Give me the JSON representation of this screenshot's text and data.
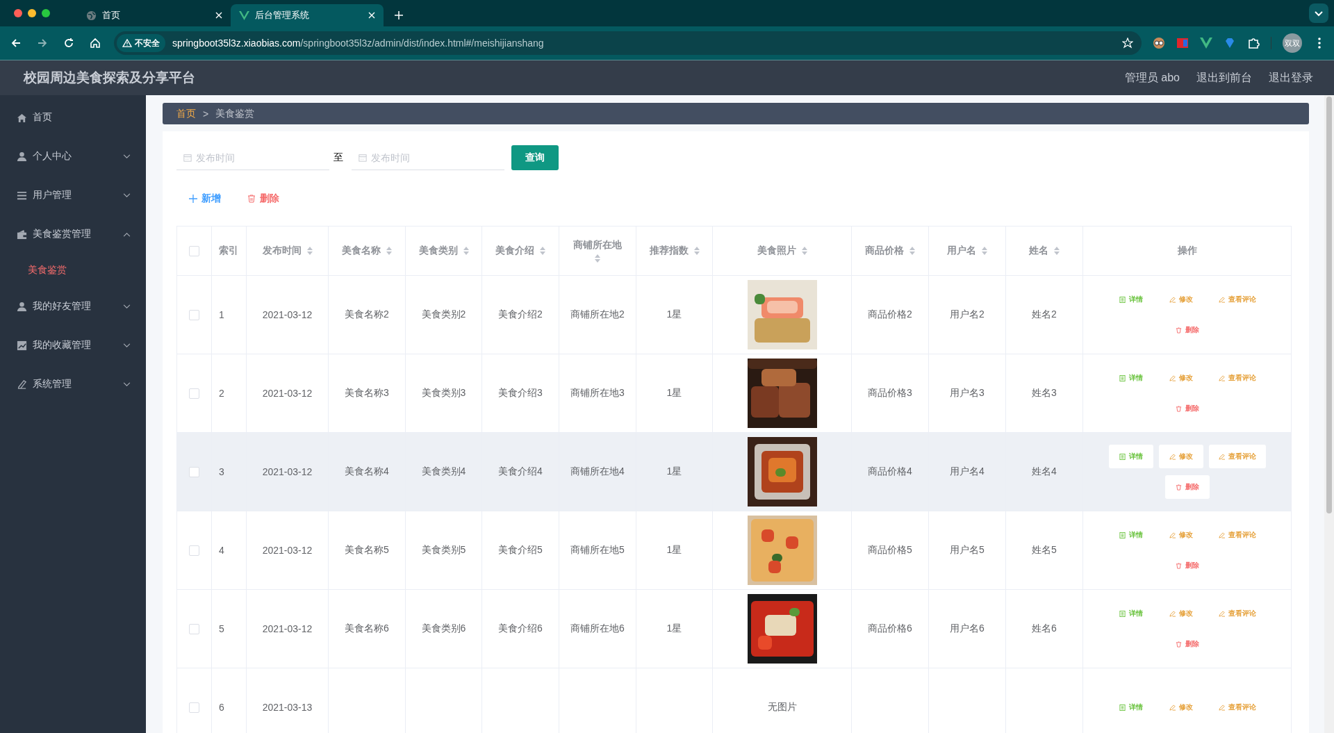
{
  "browser": {
    "tabs": [
      {
        "title": "首页",
        "selected": false
      },
      {
        "title": "后台管理系统",
        "selected": true
      }
    ],
    "security": "不安全",
    "url_host": "springboot35l3z.xiaobias.com",
    "url_path": "/springboot35l3z/admin/dist/index.html#/meishijianshang",
    "profile": "双双"
  },
  "header": {
    "title": "校园周边美食探索及分享平台",
    "links": [
      "管理员 abo",
      "退出到前台",
      "退出登录"
    ]
  },
  "sidebar": {
    "items": [
      {
        "label": "首页"
      },
      {
        "label": "个人中心",
        "expanded": false
      },
      {
        "label": "用户管理",
        "expanded": false
      },
      {
        "label": "美食鉴赏管理",
        "expanded": true,
        "children": [
          {
            "label": "美食鉴赏",
            "selected": true
          }
        ]
      },
      {
        "label": "我的好友管理",
        "expanded": false
      },
      {
        "label": "我的收藏管理",
        "expanded": false
      },
      {
        "label": "系统管理",
        "expanded": false
      }
    ]
  },
  "breadcrumb": {
    "items": [
      "首页",
      "美食鉴赏"
    ],
    "separator": ">"
  },
  "filters": {
    "start_placeholder": "发布时间",
    "separator": "至",
    "end_placeholder": "发布时间",
    "button": "查询"
  },
  "actions": [
    {
      "label": "新增",
      "kind": "add"
    },
    {
      "label": "删除",
      "kind": "delete"
    }
  ],
  "table": {
    "select_all_checked": false,
    "columns": [
      {
        "label": "索引",
        "sortable": false
      },
      {
        "label": "发布时间",
        "sortable": true
      },
      {
        "label": "美食名称",
        "sortable": true
      },
      {
        "label": "美食类别",
        "sortable": true
      },
      {
        "label": "美食介绍",
        "sortable": true
      },
      {
        "label": "商铺所在地",
        "sortable": true
      },
      {
        "label": "推荐指数",
        "sortable": true
      },
      {
        "label": "美食照片",
        "sortable": true
      },
      {
        "label": "商品价格",
        "sortable": true
      },
      {
        "label": "用户名",
        "sortable": true
      },
      {
        "label": "姓名",
        "sortable": true
      },
      {
        "label": "操作",
        "sortable": false
      }
    ],
    "rows": [
      {
        "checked": false,
        "highlighted": false,
        "cells": [
          "1",
          "2021-03-12",
          "美食名称2",
          "美食类别2",
          "美食介绍2",
          "商铺所在地2",
          "1星"
        ],
        "photo": {
          "kind": "picture"
        },
        "tail": [
          "商品价格2",
          "用户名2",
          "姓名2"
        ],
        "buttons": [
          {
            "label": "详情",
            "kind": "detail"
          },
          {
            "label": "修改",
            "kind": "edit"
          },
          {
            "label": "查看评论",
            "kind": "edit"
          },
          {
            "label": "删除",
            "kind": "delete"
          }
        ]
      },
      {
        "checked": false,
        "highlighted": false,
        "cells": [
          "2",
          "2021-03-12",
          "美食名称3",
          "美食类别3",
          "美食介绍3",
          "商铺所在地3",
          "1星"
        ],
        "photo": {
          "kind": "picture"
        },
        "tail": [
          "商品价格3",
          "用户名3",
          "姓名3"
        ],
        "buttons": [
          {
            "label": "详情",
            "kind": "detail"
          },
          {
            "label": "修改",
            "kind": "edit"
          },
          {
            "label": "查看评论",
            "kind": "edit"
          },
          {
            "label": "删除",
            "kind": "delete"
          }
        ]
      },
      {
        "checked": false,
        "highlighted": true,
        "cells": [
          "3",
          "2021-03-12",
          "美食名称4",
          "美食类别4",
          "美食介绍4",
          "商铺所在地4",
          "1星"
        ],
        "photo": {
          "kind": "picture"
        },
        "tail": [
          "商品价格4",
          "用户名4",
          "姓名4"
        ],
        "buttons": [
          {
            "label": "详情",
            "kind": "detail"
          },
          {
            "label": "修改",
            "kind": "edit"
          },
          {
            "label": "查看评论",
            "kind": "edit"
          },
          {
            "label": "删除",
            "kind": "delete"
          }
        ]
      },
      {
        "checked": false,
        "highlighted": false,
        "cells": [
          "4",
          "2021-03-12",
          "美食名称5",
          "美食类别5",
          "美食介绍5",
          "商铺所在地5",
          "1星"
        ],
        "photo": {
          "kind": "picture"
        },
        "tail": [
          "商品价格5",
          "用户名5",
          "姓名5"
        ],
        "buttons": [
          {
            "label": "详情",
            "kind": "detail"
          },
          {
            "label": "修改",
            "kind": "edit"
          },
          {
            "label": "查看评论",
            "kind": "edit"
          },
          {
            "label": "删除",
            "kind": "delete"
          }
        ]
      },
      {
        "checked": false,
        "highlighted": false,
        "cells": [
          "5",
          "2021-03-12",
          "美食名称6",
          "美食类别6",
          "美食介绍6",
          "商铺所在地6",
          "1星"
        ],
        "photo": {
          "kind": "picture"
        },
        "tail": [
          "商品价格6",
          "用户名6",
          "姓名6"
        ],
        "buttons": [
          {
            "label": "详情",
            "kind": "detail"
          },
          {
            "label": "修改",
            "kind": "edit"
          },
          {
            "label": "查看评论",
            "kind": "edit"
          },
          {
            "label": "删除",
            "kind": "delete"
          }
        ]
      },
      {
        "checked": false,
        "highlighted": false,
        "cells": [
          "6",
          "2021-03-13"
        ],
        "photo": {
          "kind": "text",
          "text": "无图片"
        },
        "buttons": [
          {
            "label": "详情",
            "kind": "detail"
          },
          {
            "label": "修改",
            "kind": "edit"
          },
          {
            "label": "查看评论",
            "kind": "edit"
          }
        ]
      }
    ]
  }
}
